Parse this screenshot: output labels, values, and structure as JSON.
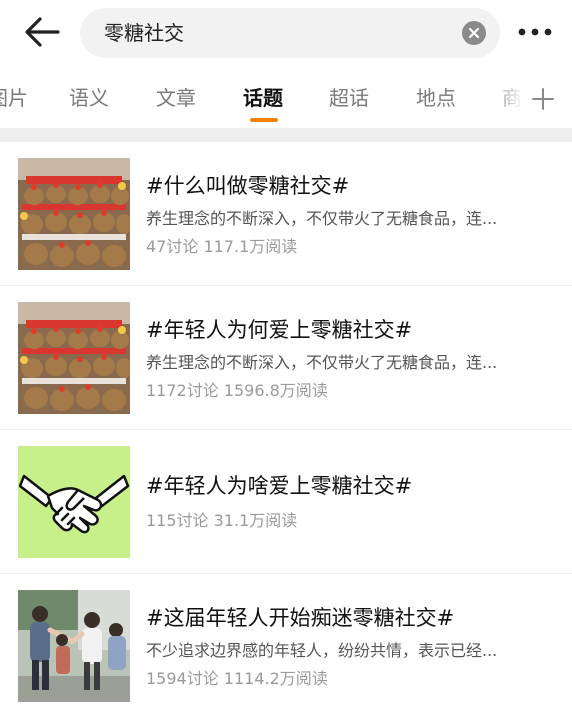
{
  "search": {
    "query": "零糖社交"
  },
  "tabs": [
    {
      "label": "图片"
    },
    {
      "label": "语义"
    },
    {
      "label": "文章"
    },
    {
      "label": "话题",
      "active": true
    },
    {
      "label": "超话"
    },
    {
      "label": "地点"
    },
    {
      "label": "商"
    }
  ],
  "results": [
    {
      "title": "#什么叫做零糖社交#",
      "desc": "养生理念的不断深入，不仅带火了无糖食品，连...",
      "meta": "47讨论 117.1万阅读",
      "thumb": "capybara-plush-display"
    },
    {
      "title": "#年轻人为何爱上零糖社交#",
      "desc": "养生理念的不断深入，不仅带火了无糖食品，连...",
      "meta": "1172讨论 1596.8万阅读",
      "thumb": "capybara-plush-display"
    },
    {
      "title": "#年轻人为啥爱上零糖社交#",
      "desc": "",
      "meta": "115讨论 31.1万阅读",
      "thumb": "handshake-illustration"
    },
    {
      "title": "#这届年轻人开始痴迷零糖社交#",
      "desc": "不少追求边界感的年轻人，纷纷共情，表示已经...",
      "meta": "1594讨论 1114.2万阅读",
      "thumb": "people-greeting-photo"
    }
  ],
  "colors": {
    "accent": "#ff8200",
    "background": "#ffffff",
    "divider": "#eeeeee"
  }
}
